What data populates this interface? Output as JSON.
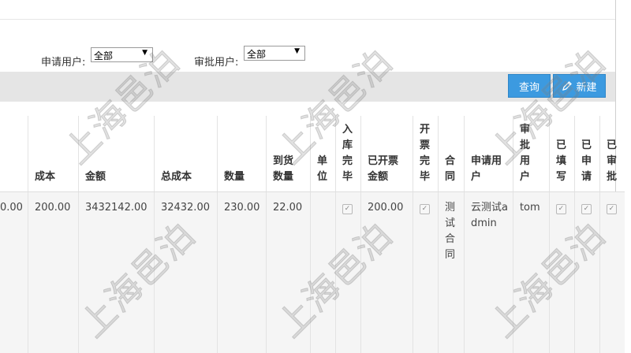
{
  "filters": {
    "applicant_label": "申请用户:",
    "applicant_value": "全部",
    "approver_label": "审批用户:",
    "approver_value": "全部"
  },
  "toolbar": {
    "query_label": "查询",
    "new_label": "新建"
  },
  "table": {
    "headers": {
      "cost": "成本",
      "amount": "金额",
      "total_cost": "总成本",
      "quantity": "数量",
      "arrived_qty": "到货数量",
      "unit": "单位",
      "stock_done": "入库完毕",
      "invoiced_amount": "已开票金额",
      "invoice_done": "开票完毕",
      "contract": "合同",
      "applicant": "申请用户",
      "approver": "审批用户",
      "filled": "已填写",
      "applied": "已申请",
      "approved": "已审批"
    },
    "row": {
      "prev_cut": "0.00",
      "cost": "200.00",
      "amount": "3432142.00",
      "total_cost": "32432.00",
      "quantity": "230.00",
      "arrived_qty": "22.00",
      "unit": "",
      "invoiced_amount": "200.00",
      "contract": "测试合同",
      "applicant": "云测试admin",
      "approver": "tom",
      "checks": {
        "stock_done": true,
        "invoice_done": true,
        "filled": true,
        "applied": true,
        "approved": true
      }
    }
  },
  "watermark_text": "上海邑泊"
}
